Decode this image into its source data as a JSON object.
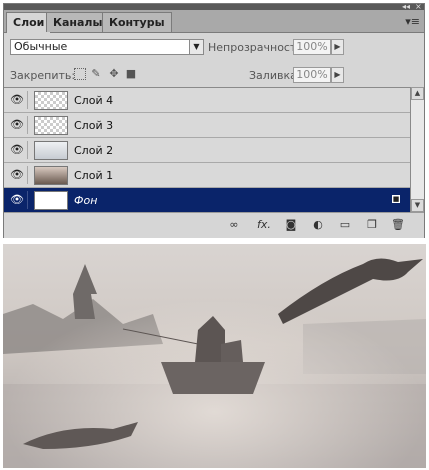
{
  "panel": {
    "tabs": [
      {
        "label": "Слои",
        "active": true
      },
      {
        "label": "Каналы",
        "active": false
      },
      {
        "label": "Контуры",
        "active": false
      }
    ],
    "blend_mode": "Обычные",
    "opacity_label": "Непрозрачность:",
    "opacity_value": "100%",
    "lock_label": "Закрепить:",
    "fill_label": "Заливка:",
    "fill_value": "100%",
    "layers": [
      {
        "name": "Слой 4",
        "selected": false
      },
      {
        "name": "Слой 3",
        "selected": false
      },
      {
        "name": "Слой 2",
        "selected": false
      },
      {
        "name": "Слой 1",
        "selected": false
      },
      {
        "name": "Фон",
        "selected": true
      }
    ],
    "selection_color": "#0a246a"
  },
  "icons": {
    "visibility": "eye-icon",
    "bottom": [
      "link-icon",
      "fx-icon",
      "mask-icon",
      "adjustment-icon",
      "group-folder-icon",
      "new-layer-icon",
      "trash-icon"
    ]
  }
}
